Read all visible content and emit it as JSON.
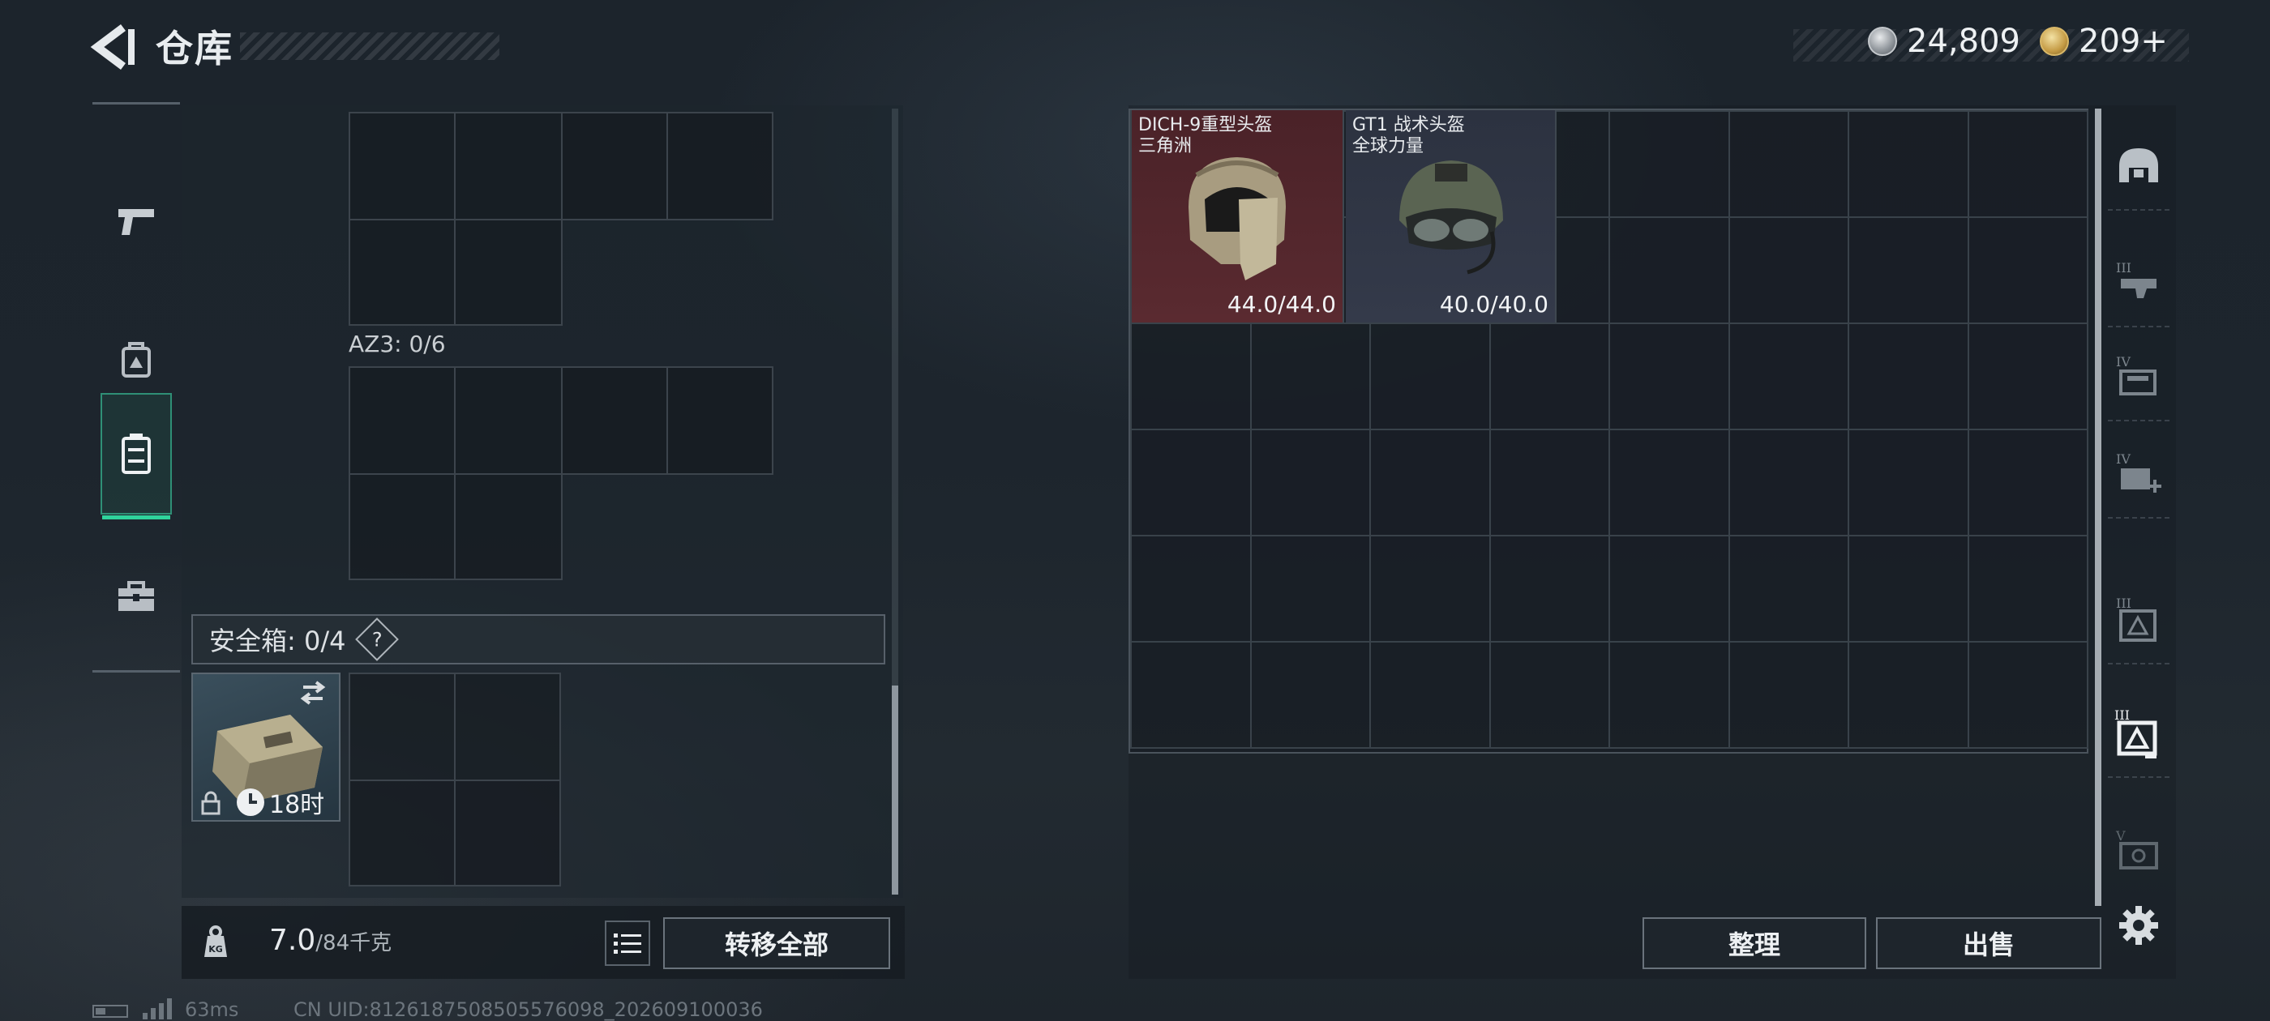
{
  "header": {
    "title": "仓库",
    "currency_silver": "24,809",
    "currency_gold": "209+"
  },
  "left_panel": {
    "tabs": [
      {
        "id": "weapons",
        "icon": "pistol-icon",
        "active": false
      },
      {
        "id": "equipment",
        "icon": "backpack-icon",
        "active": false
      },
      {
        "id": "containers",
        "icon": "container-icon",
        "active": true
      },
      {
        "id": "toolbox",
        "icon": "toolbox-icon",
        "active": false
      }
    ],
    "az3_label": "AZ3: 0/6",
    "safe_box_label": "安全箱: 0/4",
    "help_symbol": "?",
    "safe_box_timer": "18时",
    "weight_value": "7.0",
    "weight_max": "/84千克",
    "transfer_all_label": "转移全部"
  },
  "stash": {
    "items": [
      {
        "name": "DICH-9重型头盔",
        "faction": "三角洲",
        "durability": "44.0/44.0",
        "rarity_color": "#5a2a30"
      },
      {
        "name": "GT1 战术头盔",
        "faction": "全球力量",
        "durability": "40.0/40.0",
        "rarity_color": "#343a4a"
      }
    ],
    "sort_label": "整理",
    "sell_label": "出售",
    "right_tabs": [
      {
        "id": "helmet",
        "icon": "helmet-tab-icon"
      },
      {
        "id": "armor-3",
        "icon": "armor-tier-3-icon",
        "tier": "III"
      },
      {
        "id": "rig-4",
        "icon": "rig-tier-4-icon",
        "tier": "IV"
      },
      {
        "id": "medical-4",
        "icon": "medical-tier-4-icon",
        "tier": "IV"
      },
      {
        "id": "backpack-3",
        "icon": "backpack-tier-3-icon",
        "tier": "III"
      },
      {
        "id": "backpack-3-selected",
        "icon": "backpack-tier-3-selected-icon",
        "tier": "III"
      },
      {
        "id": "safe-5",
        "icon": "safe-tier-5-icon",
        "tier": "V"
      }
    ]
  },
  "status_bar": {
    "ping": "63ms",
    "uid": "CN UID:8126187508505576098_202609100036"
  },
  "colors": {
    "accent": "#2fd49c",
    "background": "#1d252d",
    "item_red": "#5a2a30",
    "item_blue": "#343a4a"
  }
}
